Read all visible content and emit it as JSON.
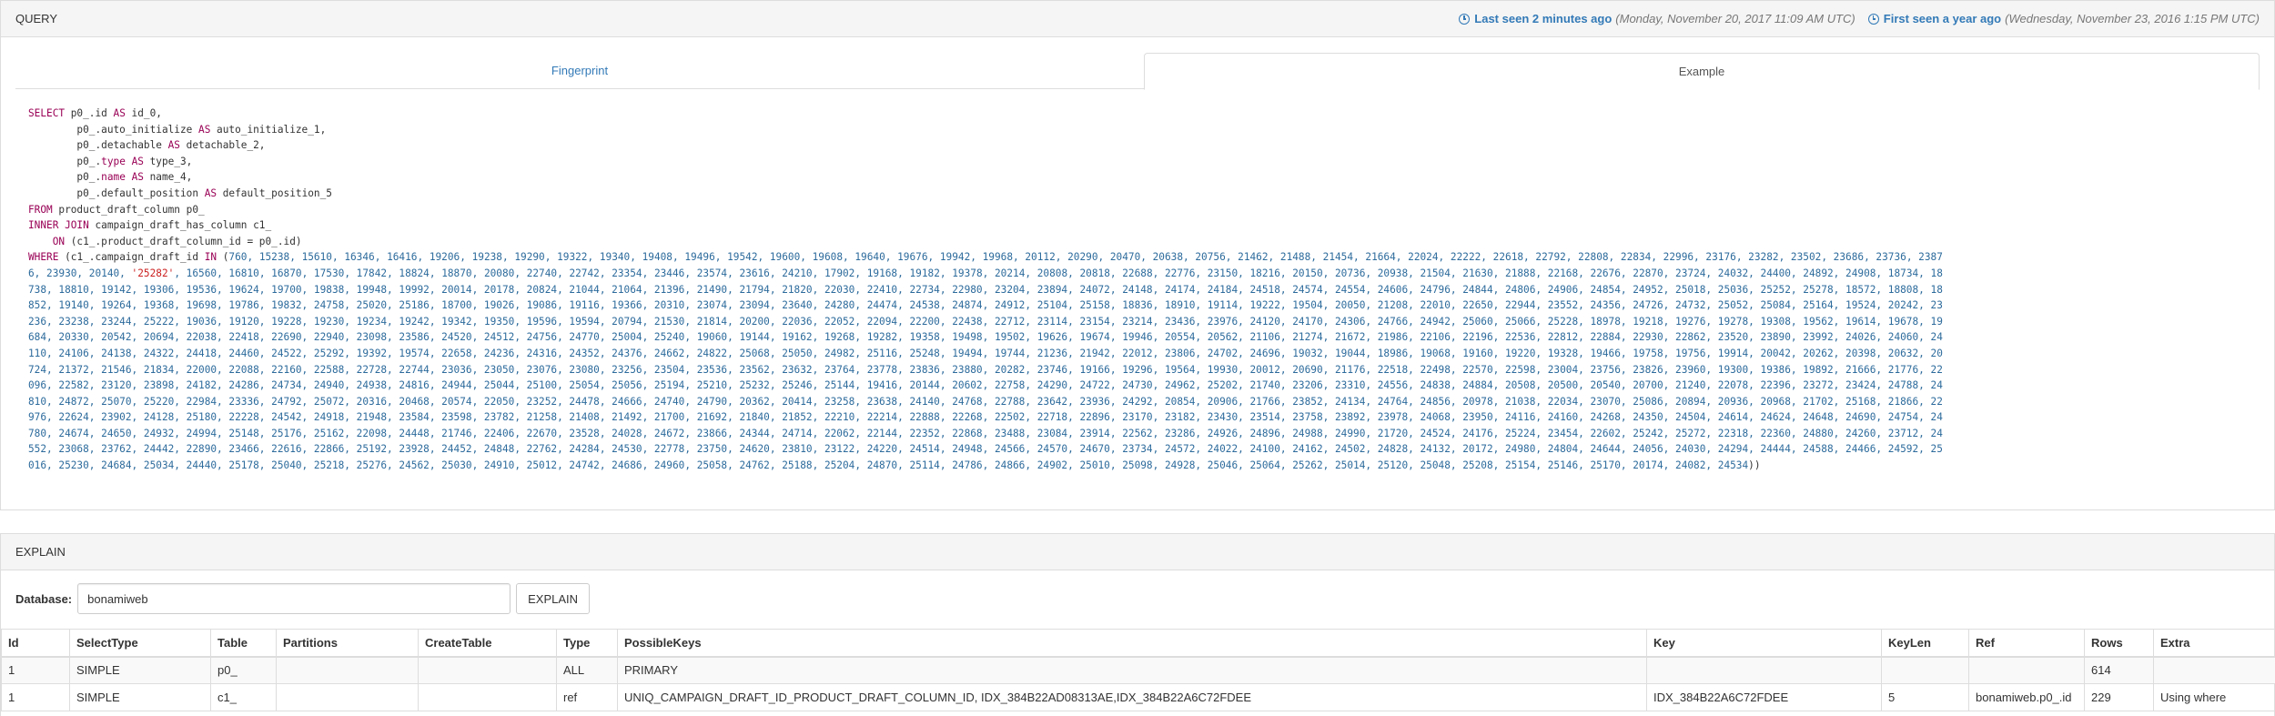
{
  "query_panel": {
    "title": "QUERY",
    "last_seen_link": "Last seen 2 minutes ago",
    "last_seen_date": "(Monday, November 20, 2017 11:09 AM UTC)",
    "first_seen_link": "First seen a year ago",
    "first_seen_date": "(Wednesday, November 23, 2016 1:15 PM UTC)",
    "tabs": [
      {
        "label": "Fingerprint"
      },
      {
        "label": "Example"
      }
    ],
    "sql_lines": [
      [
        [
          "k",
          "SELECT"
        ],
        [
          "t",
          " p0_.id "
        ],
        [
          "k",
          "AS"
        ],
        [
          "t",
          " id_0,"
        ]
      ],
      [
        [
          "t",
          "        p0_.auto_initialize "
        ],
        [
          "k",
          "AS"
        ],
        [
          "t",
          " auto_initialize_1,"
        ]
      ],
      [
        [
          "t",
          "        p0_.detachable "
        ],
        [
          "k",
          "AS"
        ],
        [
          "t",
          " detachable_2,"
        ]
      ],
      [
        [
          "t",
          "        p0_."
        ],
        [
          "k",
          "type"
        ],
        [
          "t",
          " "
        ],
        [
          "k",
          "AS"
        ],
        [
          "t",
          " type_3,"
        ]
      ],
      [
        [
          "t",
          "        p0_."
        ],
        [
          "k",
          "name"
        ],
        [
          "t",
          " "
        ],
        [
          "k",
          "AS"
        ],
        [
          "t",
          " name_4,"
        ]
      ],
      [
        [
          "t",
          "        p0_.default_position "
        ],
        [
          "k",
          "AS"
        ],
        [
          "t",
          " default_position_5"
        ]
      ],
      [
        [
          "k",
          "FROM"
        ],
        [
          "t",
          " product_draft_column p0_"
        ]
      ],
      [
        [
          "k",
          "INNER JOIN"
        ],
        [
          "t",
          " campaign_draft_has_column c1_"
        ]
      ],
      [
        [
          "t",
          "    "
        ],
        [
          "k",
          "ON"
        ],
        [
          "t",
          " (c1_.product_draft_column_id = p0_.id)"
        ]
      ],
      [
        [
          "k",
          "WHERE"
        ],
        [
          "t",
          " (c1_.campaign_draft_id "
        ],
        [
          "k",
          "IN"
        ],
        [
          "t",
          " ("
        ],
        [
          "n",
          "760, 15238, 15610, 16346, 16416, 19206, 19238, 19290, 19322, 19340, 19408, 19496, 19542, 19600, 19608, 19640, 19676, 19942, 19968, 20112, 20290, 20470, 20638, 20756, 21462, 21488, 21454, 21664, 22024, 22222, 22618, 22792, 22808, 22834, 22996, 23176, 23282, 23502, 23686, 23736, 2387"
        ]
      ],
      [
        [
          "n",
          "6, 23930, 20140, "
        ],
        [
          "s",
          "'25282'"
        ],
        [
          "n",
          ", 16560, 16810, 16870, 17530, 17842, 18824, 18870, 20080, 22740, 22742, 23354, 23446, 23574, 23616, 24210, 17902, 19168, 19182, 19378, 20214, 20808, 20818, 22688, 22776, 23150, 18216, 20150, 20736, 20938, 21504, 21630, 21888, 22168, 22676, 22870, 23724, 24032, 24400, 24892, 24908, 18734, 18"
        ]
      ],
      [
        [
          "n",
          "738, 18810, 19142, 19306, 19536, 19624, 19700, 19838, 19948, 19992, 20014, 20178, 20824, 21044, 21064, 21396, 21490, 21794, 21820, 22030, 22410, 22734, 22980, 23204, 23894, 24072, 24148, 24174, 24184, 24518, 24574, 24554, 24606, 24796, 24844, 24806, 24906, 24854, 24952, 25018, 25036, 25252, 25278, 18572, 18808, 18"
        ]
      ],
      [
        [
          "n",
          "852, 19140, 19264, 19368, 19698, 19786, 19832, 24758, 25020, 25186, 18700, 19026, 19086, 19116, 19366, 20310, 23074, 23094, 23640, 24280, 24474, 24538, 24874, 24912, 25104, 25158, 18836, 18910, 19114, 19222, 19504, 20050, 21208, 22010, 22650, 22944, 23552, 24356, 24726, 24732, 25052, 25084, 25164, 19524, 20242, 23"
        ]
      ],
      [
        [
          "n",
          "236, 23238, 23244, 25222, 19036, 19120, 19228, 19230, 19234, 19242, 19342, 19350, 19596, 19594, 20794, 21530, 21814, 20200, 22036, 22052, 22094, 22200, 22438, 22712, 23114, 23154, 23214, 23436, 23976, 24120, 24170, 24306, 24766, 24942, 25060, 25066, 25228, 18978, 19218, 19276, 19278, 19308, 19562, 19614, 19678, 19"
        ]
      ],
      [
        [
          "n",
          "684, 20330, 20542, 20694, 22038, 22418, 22690, 22940, 23098, 23586, 24520, 24512, 24756, 24770, 25004, 25240, 19060, 19144, 19162, 19268, 19282, 19358, 19498, 19502, 19626, 19674, 19946, 20554, 20562, 21106, 21274, 21672, 21986, 22106, 22196, 22536, 22812, 22884, 22930, 22862, 23520, 23890, 23992, 24026, 24060, 24"
        ]
      ],
      [
        [
          "n",
          "110, 24106, 24138, 24322, 24418, 24460, 24522, 25292, 19392, 19574, 22658, 24236, 24316, 24352, 24376, 24662, 24822, 25068, 25050, 24982, 25116, 25248, 19494, 19744, 21236, 21942, 22012, 23806, 24702, 24696, 19032, 19044, 18986, 19068, 19160, 19220, 19328, 19466, 19758, 19756, 19914, 20042, 20262, 20398, 20632, 20"
        ]
      ],
      [
        [
          "n",
          "724, 21372, 21546, 21834, 22000, 22088, 22160, 22588, 22728, 22744, 23036, 23050, 23076, 23080, 23256, 23504, 23536, 23562, 23632, 23764, 23778, 23836, 23880, 20282, 23746, 19166, 19296, 19564, 19930, 20012, 20690, 21176, 22518, 22498, 22570, 22598, 23004, 23756, 23826, 23960, 19300, 19386, 19892, 21666, 21776, 22"
        ]
      ],
      [
        [
          "n",
          "096, 22582, 23120, 23898, 24182, 24286, 24734, 24940, 24938, 24816, 24944, 25044, 25100, 25054, 25056, 25194, 25210, 25232, 25246, 25144, 19416, 20144, 20602, 22758, 24290, 24722, 24730, 24962, 25202, 21740, 23206, 23310, 24556, 24838, 24884, 20508, 20500, 20540, 20700, 21240, 22078, 22396, 23272, 23424, 24788, 24"
        ]
      ],
      [
        [
          "n",
          "810, 24872, 25070, 25220, 22984, 23336, 24792, 25072, 20316, 20468, 20574, 22050, 23252, 24478, 24666, 24740, 24790, 20362, 20414, 23258, 23638, 24140, 24768, 22788, 23642, 23936, 24292, 20854, 20906, 21766, 23852, 24134, 24764, 24856, 20978, 21038, 22034, 23070, 25086, 20894, 20936, 20968, 21702, 25168, 21866, 22"
        ]
      ],
      [
        [
          "n",
          "976, 22624, 23902, 24128, 25180, 22228, 24542, 24918, 21948, 23584, 23598, 23782, 21258, 21408, 21492, 21700, 21692, 21840, 21852, 22210, 22214, 22888, 22268, 22502, 22718, 22896, 23170, 23182, 23430, 23514, 23758, 23892, 23978, 24068, 23950, 24116, 24160, 24268, 24350, 24504, 24614, 24624, 24648, 24690, 24754, 24"
        ]
      ],
      [
        [
          "n",
          "780, 24674, 24650, 24932, 24994, 25148, 25176, 25162, 22098, 24448, 21746, 22406, 22670, 23528, 24028, 24672, 23866, 24344, 24714, 22062, 22144, 22352, 22868, 23488, 23084, 23914, 22562, 23286, 24926, 24896, 24988, 24990, 21720, 24524, 24176, 25224, 23454, 22602, 25242, 25272, 22318, 22360, 24880, 24260, 23712, 24"
        ]
      ],
      [
        [
          "n",
          "552, 23068, 23762, 24442, 22890, 23466, 22616, 22866, 25192, 23928, 24452, 24848, 22762, 24284, 24530, 22778, 23750, 24620, 23810, 23122, 24220, 24514, 24948, 24566, 24570, 24670, 23734, 24572, 24022, 24100, 24162, 24502, 24828, 24132, 20172, 24980, 24804, 24644, 24056, 24030, 24294, 24444, 24588, 24466, 24592, 25"
        ]
      ],
      [
        [
          "n",
          "016, 25230, 24684, 25034, 24440, 25178, 25040, 25218, 25276, 24562, 25030, 24910, 25012, 24742, 24686, 24960, 25058, 24762, 25188, 25204, 24870, 25114, 24786, 24866, 24902, 25010, 25098, 24928, 25046, 25064, 25262, 25014, 25120, 25048, 25208, 25154, 25146, 25170, 20174, 24082, 24534"
        ],
        [
          "t",
          "))"
        ]
      ]
    ]
  },
  "explain_panel": {
    "title": "EXPLAIN",
    "database_label": "Database:",
    "database_value": "bonamiweb",
    "explain_button": "EXPLAIN",
    "columns": [
      "Id",
      "SelectType",
      "Table",
      "Partitions",
      "CreateTable",
      "Type",
      "PossibleKeys",
      "Key",
      "KeyLen",
      "Ref",
      "Rows",
      "Extra"
    ],
    "rows": [
      [
        "1",
        "SIMPLE",
        "p0_",
        "",
        "",
        "ALL",
        "PRIMARY",
        "",
        "",
        "",
        "614",
        ""
      ],
      [
        "1",
        "SIMPLE",
        "c1_",
        "",
        "",
        "ref",
        "UNIQ_CAMPAIGN_DRAFT_ID_PRODUCT_DRAFT_COLUMN_ID, IDX_384B22AD08313AE,IDX_384B22A6C72FDEE",
        "IDX_384B22A6C72FDEE",
        "5",
        "bonamiweb.p0_.id",
        "229",
        "Using where"
      ]
    ]
  },
  "colors": {
    "link": "#337ab7",
    "keyword": "#990055",
    "number": "#2d6b9c",
    "string": "#cc2222"
  }
}
